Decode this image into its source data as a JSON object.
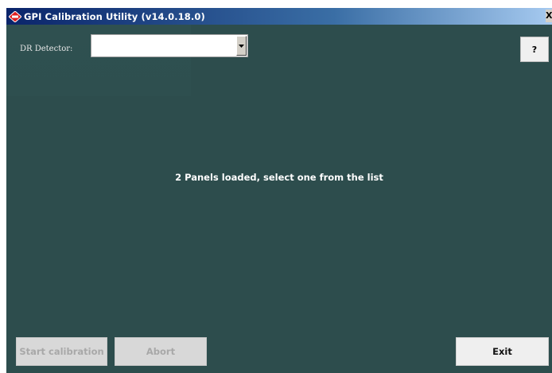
{
  "window": {
    "title": "GPI Calibration Utility (v14.0.18.0)",
    "close_glyph": "X",
    "icon": "app-logo-icon"
  },
  "detector": {
    "label": "DR Detector:",
    "selected_value": "",
    "dropdown_icon": "chevron-down-icon"
  },
  "help": {
    "label": "?"
  },
  "status": {
    "message": "2 Panels loaded, select one from the list"
  },
  "buttons": {
    "start_calibration": "Start calibration",
    "abort": "Abort",
    "exit": "Exit"
  },
  "colors": {
    "background": "#2d4d4d",
    "title_start": "#0a246a",
    "title_end": "#a6caf0",
    "disabled_text": "#a8a8a8"
  }
}
